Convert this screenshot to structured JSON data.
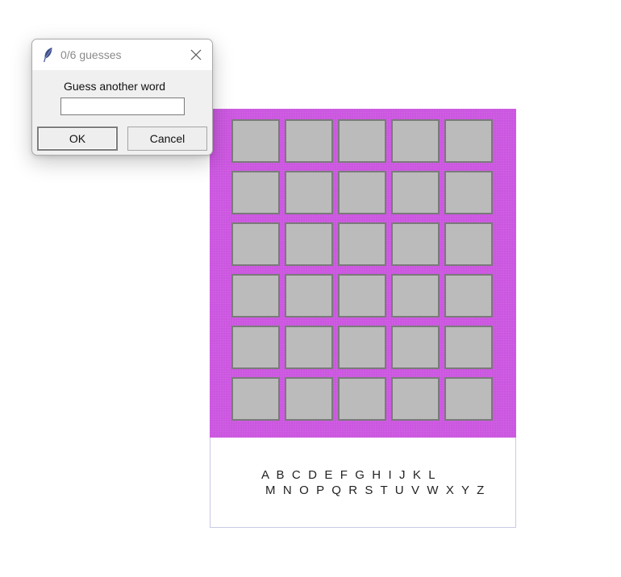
{
  "dialog": {
    "title": "0/6 guesses",
    "title_icon": "feather-icon",
    "close_icon": "close-icon",
    "prompt": "Guess another word",
    "input_value": "",
    "ok_label": "OK",
    "cancel_label": "Cancel"
  },
  "board": {
    "rows": 6,
    "columns": 5,
    "background_color": "#cb55e0",
    "tile_color": "#c4c4c4",
    "tiles": [
      [
        "",
        "",
        "",
        "",
        ""
      ],
      [
        "",
        "",
        "",
        "",
        ""
      ],
      [
        "",
        "",
        "",
        "",
        ""
      ],
      [
        "",
        "",
        "",
        "",
        ""
      ],
      [
        "",
        "",
        "",
        "",
        ""
      ],
      [
        "",
        "",
        "",
        "",
        ""
      ]
    ]
  },
  "alphabet": {
    "line1": "A B C D E F G H I J K L",
    "line2": "M N O P Q R S T U V W X Y Z"
  }
}
